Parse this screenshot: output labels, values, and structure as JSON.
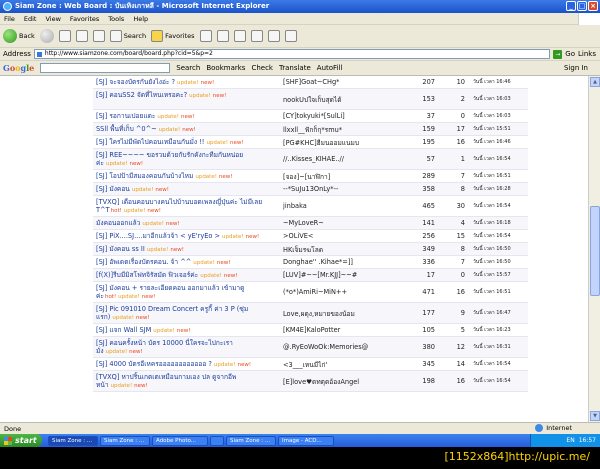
{
  "window": {
    "title": "Siam Zone : Web Board : บันเทิงเกาหลี - Microsoft Internet Explorer",
    "min": "_",
    "max": "□",
    "close": "×"
  },
  "menu": [
    "File",
    "Edit",
    "View",
    "Favorites",
    "Tools",
    "Help"
  ],
  "toolbar": {
    "back": "Back",
    "search": "Search",
    "favorites": "Favorites"
  },
  "address": {
    "label": "Address",
    "url": "http://www.siamzone.com/board/board.php?cid=5&p=2",
    "go": "Go",
    "links": "Links"
  },
  "google": {
    "search": "Search",
    "bookmarks": "Bookmarks",
    "check": "Check",
    "translate": "Translate",
    "autofill": "AutoFill",
    "sign_in": "Sign In"
  },
  "badges": {
    "hot": "hot!",
    "update": "update!",
    "new": "new!"
  },
  "rows": [
    {
      "title": "[SJ] จะจองบัตรกันยังไงอ่ะ ?",
      "hot": false,
      "user": "[SHF]Goat~CHg*",
      "replies": "207",
      "views": "10",
      "time": "วันนี้ เวลา 16:46"
    },
    {
      "title": "[SJ] คอนSS2 จัดที่ไหนเหรอคะ?",
      "hot": false,
      "user": "nookUปใจเก็บสุดได้",
      "replies": "153",
      "views": "2",
      "time": "วันนี้ เวลา 16:03"
    },
    {
      "title": "[SJ] รอกานเปอยแดะ",
      "hot": false,
      "user": "[CY]tokyuki*[SulLi]",
      "replies": "37",
      "views": "0",
      "time": "วันนี้ เวลา 16:03"
    },
    {
      "title": "SSll พื้นที่เก็บ ^0^~",
      "hot": false,
      "user": "llxxll__ฟักก็กุ*รmu*",
      "replies": "159",
      "views": "17",
      "time": "วันนี้ เวลา 15:51"
    },
    {
      "title": "[SJ] ใครไม่มีพัดไปคอนเหมือนกันมั่ง !!",
      "hot": false,
      "user": "[PG#KHC]ฮีมนออมแนมบ",
      "replies": "195",
      "views": "16",
      "time": "วันนี้ เวลา 16:46"
    },
    {
      "title": "[SJ] REE~~~~ ขอรวมด้วยกับรักคังกะทีมกันหน่อยค่ะ",
      "hot": false,
      "user": "//..Kisses_KIHAE..//",
      "replies": "57",
      "views": "1",
      "time": "วันนี้ เวลา 16:54"
    },
    {
      "title": "[SJ] โอปป้ามีสมองคอนกันบ้างไหม",
      "hot": false,
      "user": "[จอง]~[นาฬิกา]",
      "replies": "289",
      "views": "7",
      "time": "วันนี้ เวลา 16:51"
    },
    {
      "title": "[SJ] มังคอน",
      "hot": false,
      "user": "--*SuJu13OnLy*--",
      "replies": "358",
      "views": "8",
      "time": "วันนี้ เวลา 16:28"
    },
    {
      "title": "[TVXQ] เดือนคอนบางคนไปบ้านบอดเพลงญี่ปุ่นค่ะ ไม่มีเลย T^T",
      "hot": true,
      "user": "jinbaka",
      "replies": "465",
      "views": "30",
      "time": "วันนี้ เวลา 16:54"
    },
    {
      "title": "มังคอนออกแล้ว",
      "hot": false,
      "user": "~MyLoveR~",
      "replies": "141",
      "views": "4",
      "time": "วันนี้ เวลา 16:18"
    },
    {
      "title": "[SJ] PiX....SJ....มาอีกแล้วจ้า < yE'ryEo >",
      "hot": false,
      "user": ">OLiVE<",
      "replies": "256",
      "views": "15",
      "time": "วันนี้ เวลา 16:54"
    },
    {
      "title": "[SJ] มังคอน ss II",
      "hot": false,
      "user": "HKเจ็มรฆโลด",
      "replies": "349",
      "views": "8",
      "time": "วันนี้ เวลา 16:50"
    },
    {
      "title": "[SJ] อัพเดตเรื่องบัตรคอน. จ้า ^^",
      "hot": false,
      "user": "Donghae'' .Kihae*=]]",
      "replies": "336",
      "views": "7",
      "time": "วันนี้ เวลา 16:50"
    },
    {
      "title": "[f(X)]รีบมีมิสโฟทจิรัสมัด ฟิวเจอร์ค่ะ",
      "hot": false,
      "user": "[LUV]#~~[Mr.KJJ]~~#",
      "replies": "17",
      "views": "0",
      "time": "วันนี้ เวลา 15:57"
    },
    {
      "title": "[SJ] มังคอน + รายละเอียดคอน ออกมาแล้ว เข้ามาดูค่ะ",
      "hot": true,
      "user": "(*o*)AmiRi~MiN++",
      "replies": "471",
      "views": "16",
      "time": "วันนี้ เวลา 16:51"
    },
    {
      "title": "[SJ] Pic 091010 Dream Concert ครูกี้ ค่า 3 P (ซุ่มแรก)",
      "hot": false,
      "user": "Love,ผดุง,หมายของน้อม",
      "replies": "177",
      "views": "9",
      "time": "วันนี้ เวลา 16:47"
    },
    {
      "title": "[SJ] แจก Wall SJM",
      "hot": false,
      "user": "[KM4E]KaloPotter",
      "replies": "105",
      "views": "5",
      "time": "วันนี้ เวลา 16:23"
    },
    {
      "title": "[SJ] คอนครั้งหน้า บัตร 10000 นี่ใครจะไปกะเรามั่ง",
      "hot": false,
      "user": "@.RyEoWoOk:Memories@",
      "replies": "380",
      "views": "12",
      "time": "วันนี้ เวลา 16:31"
    },
    {
      "title": "[SJ] 4000 บัตรอีเหครออออออออออออ ?",
      "hot": false,
      "user": "<3___เหนมีไก่'",
      "replies": "345",
      "views": "14",
      "time": "วันนี้ เวลา 16:54"
    },
    {
      "title": "[TVXQ] หาปริ้นเกตเตเหมือนกามเอง ปล ดูจากอีพหน้า",
      "hot": false,
      "user": "[E]love♥ดทตุดอ้องAngel",
      "replies": "198",
      "views": "16",
      "time": "วันนี้ เวลา 16:54"
    }
  ],
  "status": {
    "text": "Done",
    "zone": "Internet"
  },
  "taskbar": {
    "start": "start",
    "tasks": [
      "Siam Zone : ...",
      "Siam Zone : ...",
      "Adobe Photo...",
      "",
      "Siam Zone : ...",
      "Image - ACD..."
    ],
    "lang": "EN",
    "clock": "16:57"
  },
  "footer": "[1152x864]http://upic.me/"
}
